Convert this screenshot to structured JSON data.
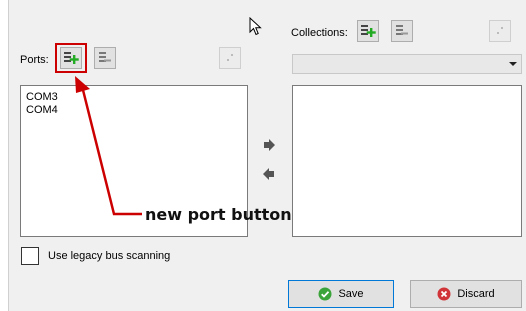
{
  "ports": {
    "label": "Ports:",
    "items": [
      "COM3",
      "COM4"
    ],
    "add_icon": "add-port-icon",
    "remove_icon": "remove-port-icon",
    "misc_icon": "resize-grip-icon"
  },
  "collections": {
    "label": "Collections:",
    "items": [],
    "selected": "",
    "add_icon": "add-collection-icon",
    "remove_icon": "remove-collection-icon"
  },
  "move_right_icon": "arrow-right-icon",
  "move_left_icon": "arrow-left-icon",
  "legacy_checkbox": {
    "label": "Use legacy bus scanning",
    "checked": false
  },
  "buttons": {
    "save_label": "Save",
    "discard_label": "Discard"
  },
  "annotation": {
    "text": "new port button",
    "color": "#cc0000"
  },
  "colors": {
    "save_icon": "#3aa43a",
    "discard_icon": "#d13438",
    "add_plus": "#22aa22",
    "highlight": "#cc0000"
  }
}
